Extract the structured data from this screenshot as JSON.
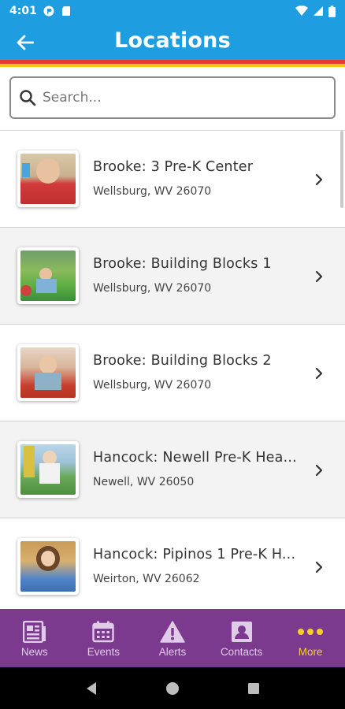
{
  "status_bar": {
    "time": "4:01"
  },
  "header": {
    "title": "Locations"
  },
  "search": {
    "placeholder": "Search..."
  },
  "locations": [
    {
      "name": "Brooke: 3 Pre-K Center",
      "address": "Wellsburg, WV 26070"
    },
    {
      "name": "Brooke: Building Blocks 1",
      "address": "Wellsburg, WV 26070"
    },
    {
      "name": "Brooke: Building Blocks 2",
      "address": "Wellsburg, WV 26070"
    },
    {
      "name": "Hancock: Newell Pre-K Hea...",
      "address": "Newell, WV 26050"
    },
    {
      "name": "Hancock: Pipinos 1 Pre-K H...",
      "address": "Weirton, WV 26062"
    }
  ],
  "bottom_nav": {
    "items": [
      {
        "label": "News",
        "icon": "newspaper-icon"
      },
      {
        "label": "Events",
        "icon": "calendar-icon"
      },
      {
        "label": "Alerts",
        "icon": "warning-icon"
      },
      {
        "label": "Contacts",
        "icon": "contact-card-icon"
      },
      {
        "label": "More",
        "icon": "more-dots-icon"
      }
    ],
    "active_index": 4
  },
  "colors": {
    "header_blue": "#1e9ee0",
    "stripe_red": "#e53b2c",
    "stripe_yellow": "#f9c21a",
    "nav_purple": "#7b3a8e",
    "nav_active": "#f6cf2f"
  }
}
